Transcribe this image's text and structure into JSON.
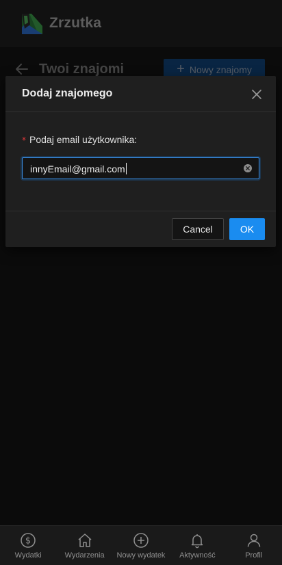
{
  "app": {
    "title": "Zrzutka"
  },
  "page": {
    "title": "Twoi znajomi",
    "new_friend_label": "Nowy znajomy"
  },
  "modal": {
    "title": "Dodaj znajomego",
    "field_label": "Podaj email użytkownika:",
    "required_mark": "*",
    "email_value": "innyEmail@gmail.com",
    "cancel_label": "Cancel",
    "ok_label": "OK"
  },
  "tabbar": {
    "items": [
      {
        "label": "Wydatki",
        "icon": "dollar-circle-icon"
      },
      {
        "label": "Wydarzenia",
        "icon": "home-icon"
      },
      {
        "label": "Nowy wydatek",
        "icon": "plus-circle-icon"
      },
      {
        "label": "Aktywność",
        "icon": "bell-icon"
      },
      {
        "label": "Profil",
        "icon": "user-icon"
      }
    ]
  },
  "colors": {
    "primary": "#1a8cf0",
    "required": "#e0393b",
    "background": "#141414"
  }
}
